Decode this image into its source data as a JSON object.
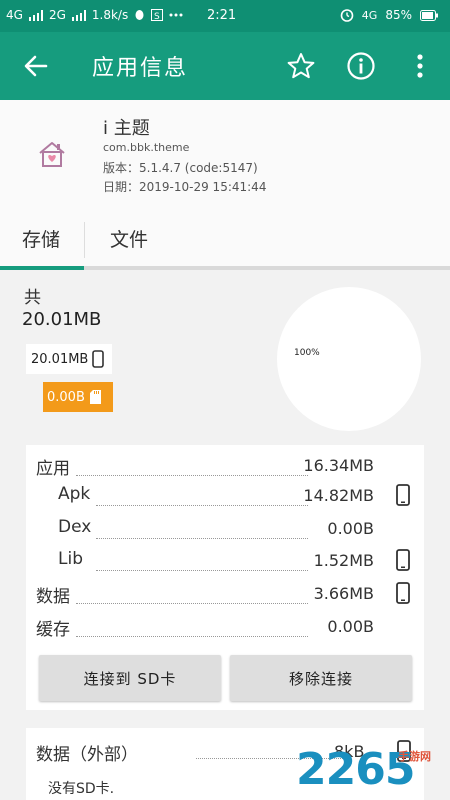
{
  "status_bar": {
    "left": [
      "4G",
      "2G",
      "1.8k/s"
    ],
    "time": "2:21",
    "network": "4G",
    "battery": "85%"
  },
  "app_bar": {
    "title": "应用信息"
  },
  "app": {
    "name": "i 主题",
    "package": "com.bbk.theme",
    "version": "版本：5.1.4.7 (code:5147)",
    "date": "日期：2019-10-29 15:41:44"
  },
  "tabs": [
    "存储",
    "文件"
  ],
  "storage": {
    "total_label": "共",
    "total_value": "20.01MB",
    "internal": "20.01MB",
    "sd": "0.00B",
    "pie_label": "100%"
  },
  "details": [
    {
      "label": "应用",
      "value": "16.34MB",
      "indent": false,
      "device": false
    },
    {
      "label": "Apk",
      "value": "14.82MB",
      "indent": true,
      "device": true
    },
    {
      "label": "Dex",
      "value": "0.00B",
      "indent": true,
      "device": false
    },
    {
      "label": "Lib",
      "value": "1.52MB",
      "indent": true,
      "device": true
    },
    {
      "label": "数据",
      "value": "3.66MB",
      "indent": false,
      "device": true
    },
    {
      "label": "缓存",
      "value": "0.00B",
      "indent": false,
      "device": false
    }
  ],
  "buttons": {
    "connect_sd": "连接到 SD卡",
    "remove_link": "移除连接"
  },
  "external": {
    "label": "数据（外部）",
    "value": "8kB",
    "note": "没有SD卡."
  },
  "watermark": {
    "main": "2265",
    "sub": "手游网"
  },
  "colors": {
    "status_bar": "#0f8f73",
    "app_bar": "#169c7e",
    "sd_chip": "#f39a1a"
  }
}
